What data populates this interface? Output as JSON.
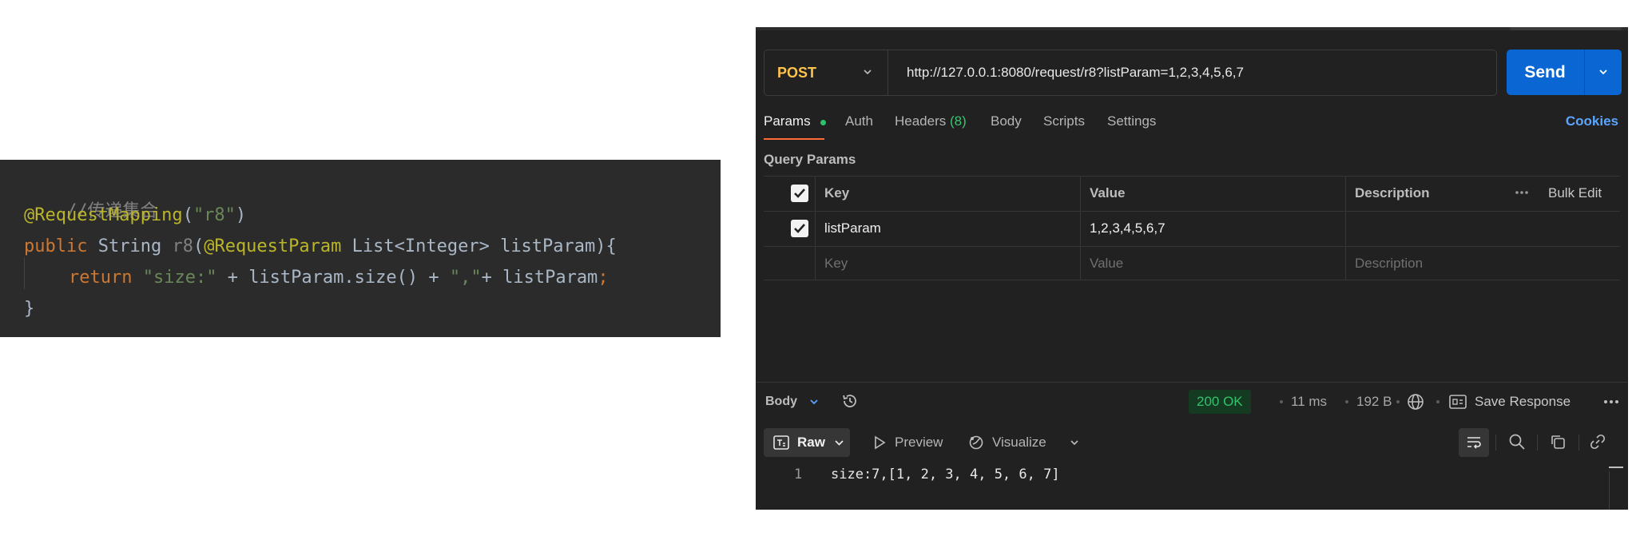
{
  "code": {
    "comment": "//传递集合",
    "annotation_name": "@RequestMapping",
    "annotation_open": "(",
    "annotation_arg": "\"r8\"",
    "annotation_close": ")",
    "sig_public": "public",
    "sig_type": " String ",
    "sig_name": "r8",
    "sig_paren": "(",
    "sig_param_anno": "@RequestParam",
    "sig_param": " List<Integer> listParam){",
    "ret_kw": "return",
    "ret_str1": "\"size:\"",
    "ret_mid": " + listParam.size() + ",
    "ret_str2": "\",\"",
    "ret_end": "+ listParam",
    "ret_semi": ";",
    "close_brace": "}"
  },
  "request": {
    "method": "POST",
    "url": "http://127.0.0.1:8080/request/r8?listParam=1,2,3,4,5,6,7",
    "send_label": "Send"
  },
  "tabs": {
    "params": "Params",
    "auth": "Auth",
    "headers": "Headers",
    "headers_count": "(8)",
    "body": "Body",
    "scripts": "Scripts",
    "settings": "Settings",
    "cookies": "Cookies"
  },
  "query_params": {
    "title": "Query Params",
    "headers": {
      "key": "Key",
      "value": "Value",
      "description": "Description",
      "bulk_edit": "Bulk Edit"
    },
    "rows": [
      {
        "key": "listParam",
        "value": "1,2,3,4,5,6,7",
        "description": "",
        "checked": true
      }
    ],
    "placeholders": {
      "key": "Key",
      "value": "Value",
      "description": "Description"
    }
  },
  "response": {
    "body_label": "Body",
    "status": "200 OK",
    "time": "11 ms",
    "size": "192 B",
    "save_label": "Save Response",
    "raw_label": "Raw",
    "preview_label": "Preview",
    "visualize_label": "Visualize",
    "line_number": "1",
    "content": "size:7,[1, 2, 3, 4, 5, 6, 7]"
  },
  "colors": {
    "method": "#ffc24b",
    "send": "#0a66d2",
    "status_ok": "#32c36c",
    "accent_tab": "#ff6c37",
    "cookies": "#5aa5ff"
  }
}
